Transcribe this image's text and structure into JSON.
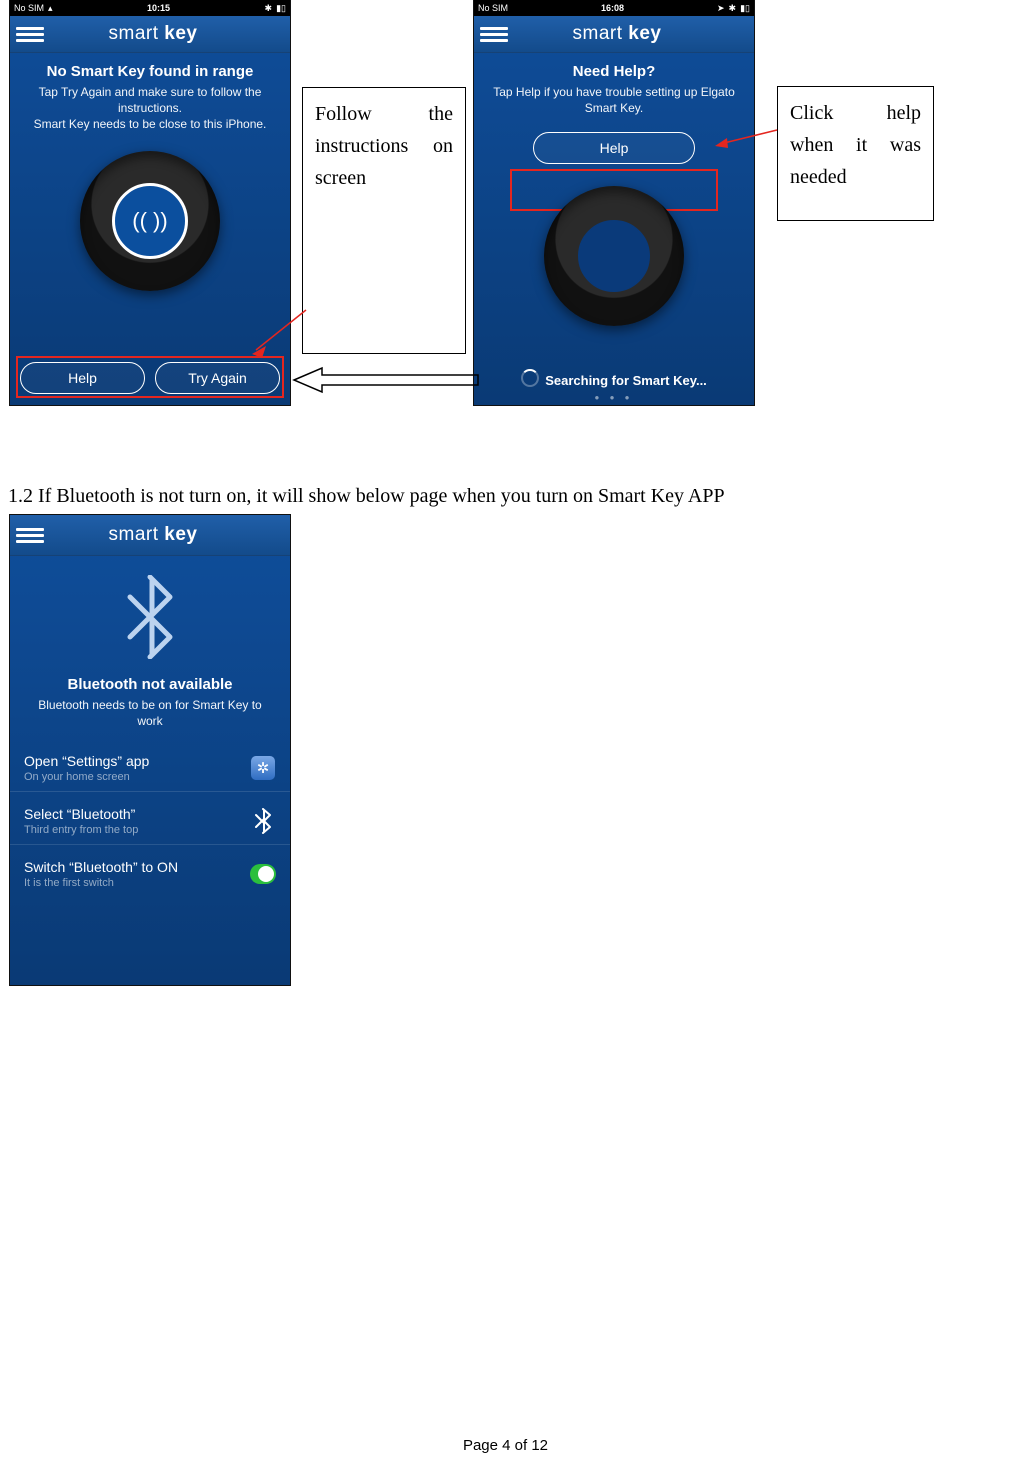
{
  "phones": {
    "p1": {
      "status": {
        "left": "No SIM",
        "clock": "10:15"
      },
      "title_light": "smart ",
      "title_bold": "key",
      "headline": "No Smart Key found in range",
      "sub": "Tap Try Again and make sure to follow the instructions.\nSmart Key needs to be close to this iPhone.",
      "center_glyph": "(( ))",
      "btn_help": "Help",
      "btn_try": "Try Again"
    },
    "p2": {
      "status": {
        "left": "No SIM",
        "clock": "16:08"
      },
      "title_light": "smart ",
      "title_bold": "key",
      "headline": "Need Help?",
      "sub": "Tap Help if you have trouble setting up Elgato Smart Key.",
      "btn_help": "Help",
      "searching": "Searching for Smart Key..."
    },
    "p3": {
      "title_light": "smart ",
      "title_bold": "key",
      "headline": "Bluetooth not available",
      "sub": "Bluetooth needs to be on for Smart Key to work",
      "rows": [
        {
          "t1": "Open “Settings” app",
          "t2": "On your home screen"
        },
        {
          "t1": "Select “Bluetooth”",
          "t2": "Third entry from the top"
        },
        {
          "t1": "Switch “Bluetooth” to ON",
          "t2": "It is the first switch"
        }
      ]
    }
  },
  "annotations": {
    "a1": "Follow the instructions on screen",
    "a2": "Click help when it was needed"
  },
  "section_text": "1.2 If Bluetooth is not turn on, it will show below page when you turn on Smart Key APP",
  "footer": "Page 4 of 12"
}
